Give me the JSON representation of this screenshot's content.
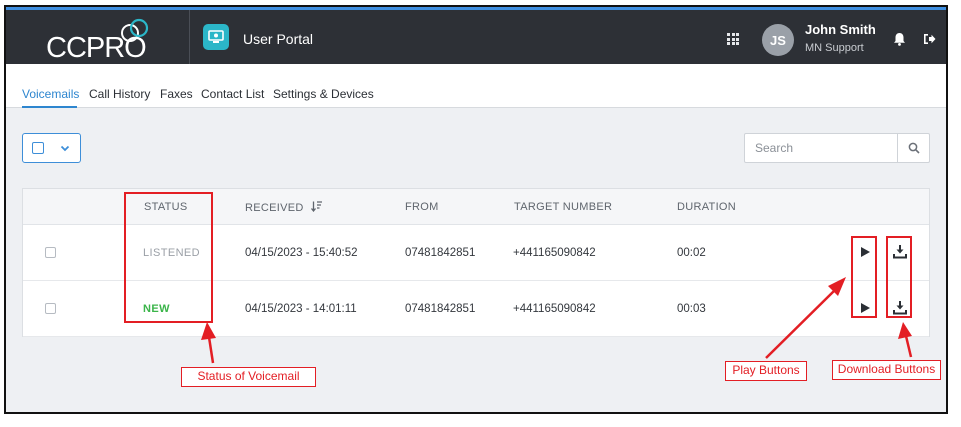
{
  "header": {
    "logo_text": "CCPRO",
    "portal_title": "User Portal",
    "user_initials": "JS",
    "user_name": "John Smith",
    "user_role": "MN Support",
    "accent_color": "#3f8fe0"
  },
  "tabs": [
    {
      "label": "Voicemails",
      "active": true
    },
    {
      "label": "Call History",
      "active": false
    },
    {
      "label": "Faxes",
      "active": false
    },
    {
      "label": "Contact List",
      "active": false
    },
    {
      "label": "Settings & Devices",
      "active": false
    }
  ],
  "search": {
    "placeholder": "Search",
    "icon": "search-icon"
  },
  "table": {
    "columns": [
      "STATUS",
      "RECEIVED",
      "FROM",
      "TARGET NUMBER",
      "DURATION"
    ],
    "rows": [
      {
        "status": "LISTENED",
        "received": "04/15/2023 - 15:40:52",
        "from": "07481842851",
        "target": "+441165090842",
        "duration": "00:02"
      },
      {
        "status": "NEW",
        "received": "04/15/2023 - 14:01:11",
        "from": "07481842851",
        "target": "+441165090842",
        "duration": "00:03"
      }
    ]
  },
  "annotations": {
    "status_label": "Status of Voicemail",
    "play_label": "Play Buttons",
    "download_label": "Download Buttons",
    "color": "#e31e24"
  }
}
